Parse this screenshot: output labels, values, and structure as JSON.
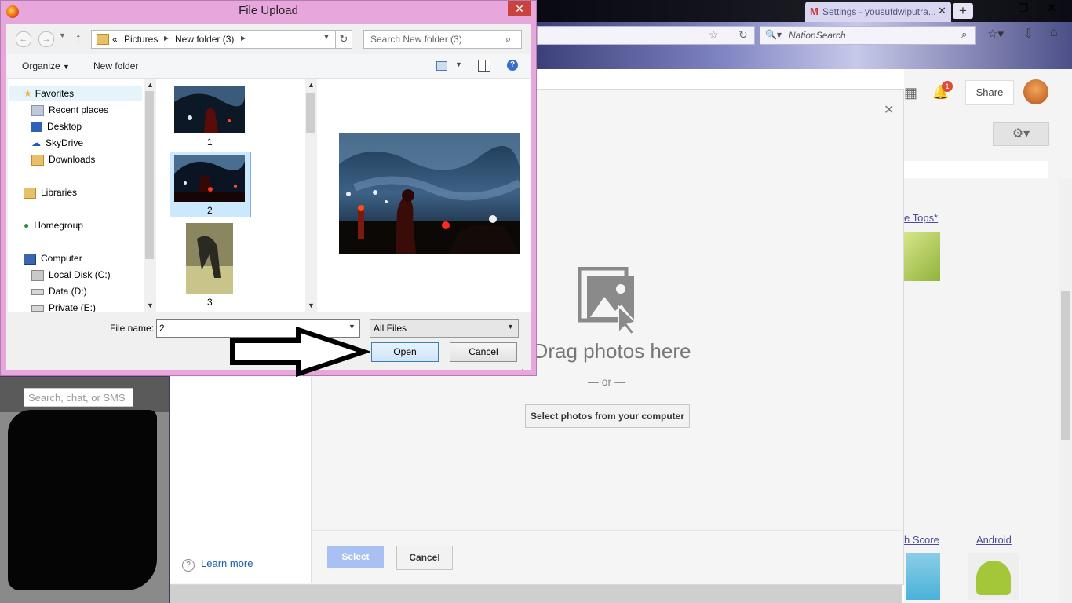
{
  "browser": {
    "tab_title": "Settings - yousufdwiputra...",
    "search_engine": "NationSearch"
  },
  "gplus": {
    "share_label": "Share",
    "notification_count": "1",
    "chat_search_placeholder": "Search, chat, or SMS",
    "bg_link_tops": "e Tops*",
    "bg_link_score": "h Score",
    "bg_link_android": "Android"
  },
  "photos_dialog": {
    "drag_text": "Drag photos here",
    "or_text": "— or —",
    "select_computer_label": "Select photos from your computer",
    "select_label": "Select",
    "cancel_label": "Cancel",
    "learn_more_label": "Learn more"
  },
  "file_dialog": {
    "title": "File Upload",
    "breadcrumb": [
      "Pictures",
      "New folder (3)"
    ],
    "breadcrumb_prefix": "«",
    "search_placeholder": "Search New folder (3)",
    "toolbar": {
      "organize_label": "Organize",
      "new_folder_label": "New folder"
    },
    "nav": {
      "favorites": "Favorites",
      "recent": "Recent places",
      "desktop": "Desktop",
      "skydrive": "SkyDrive",
      "downloads": "Downloads",
      "libraries": "Libraries",
      "homegroup": "Homegroup",
      "computer": "Computer",
      "disk_c": "Local Disk (C:)",
      "disk_d": "Data (D:)",
      "disk_e": "Private (E:)"
    },
    "files": [
      {
        "name": "1",
        "selected": false
      },
      {
        "name": "2",
        "selected": true
      },
      {
        "name": "3",
        "selected": false
      }
    ],
    "file_name_label": "File name:",
    "file_name_value": "2",
    "file_type_value": "All Files",
    "open_label": "Open",
    "cancel_label": "Cancel"
  },
  "colors": {
    "dialog_frame": "#e7a7dd",
    "selection": "#cce8ff",
    "select_button": "#a8c0f2",
    "link": "#1a5fb4"
  }
}
